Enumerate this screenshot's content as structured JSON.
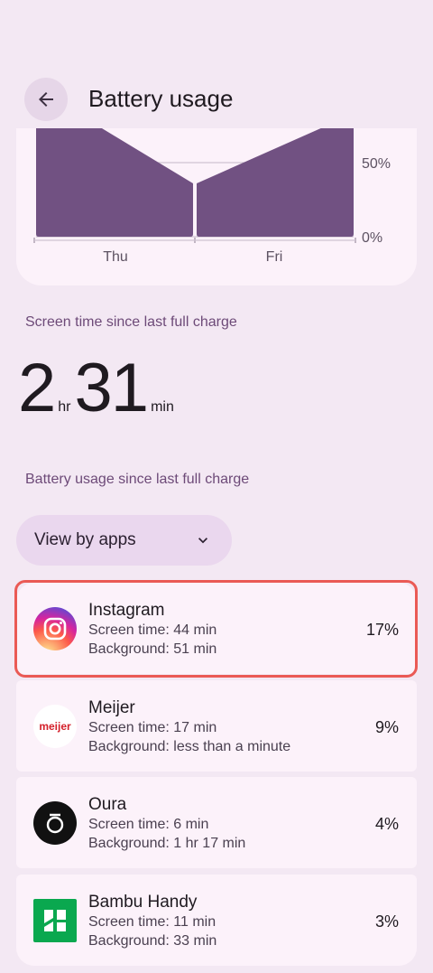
{
  "header": {
    "title": "Battery usage"
  },
  "chart_data": {
    "type": "area",
    "categories": [
      "Thu",
      "Fri"
    ],
    "y_ticks": [
      "50%",
      "0%"
    ],
    "ylim": [
      0,
      100
    ],
    "segments": [
      {
        "label": "Thu",
        "x": [
          0,
          1
        ],
        "y": [
          100,
          36
        ]
      },
      {
        "label": "Fri",
        "x": [
          1,
          2
        ],
        "y": [
          36,
          83
        ]
      }
    ],
    "fill_color": "#715182"
  },
  "screen_time": {
    "label": "Screen time since last full charge",
    "hours": "2",
    "hours_unit": "hr",
    "minutes": "31",
    "minutes_unit": "min"
  },
  "usage": {
    "label": "Battery usage since last full charge",
    "view_by": "View by apps"
  },
  "apps": [
    {
      "name": "Instagram",
      "screen": "Screen time: 44 min",
      "background": "Background: 51 min",
      "percent": "17%",
      "icon": "instagram-icon"
    },
    {
      "name": "Meijer",
      "screen": "Screen time: 17 min",
      "background": "Background: less than a minute",
      "percent": "9%",
      "icon": "meijer-icon",
      "icon_text": "meijer"
    },
    {
      "name": "Oura",
      "screen": "Screen time: 6 min",
      "background": "Background: 1 hr 17 min",
      "percent": "4%",
      "icon": "oura-icon"
    },
    {
      "name": "Bambu Handy",
      "screen": "Screen time: 11 min",
      "background": "Background: 33 min",
      "percent": "3%",
      "icon": "bambu-handy-icon"
    }
  ],
  "colors": {
    "accent": "#715182",
    "highlight": "#ea5a55",
    "background": "#f3e8f3"
  }
}
